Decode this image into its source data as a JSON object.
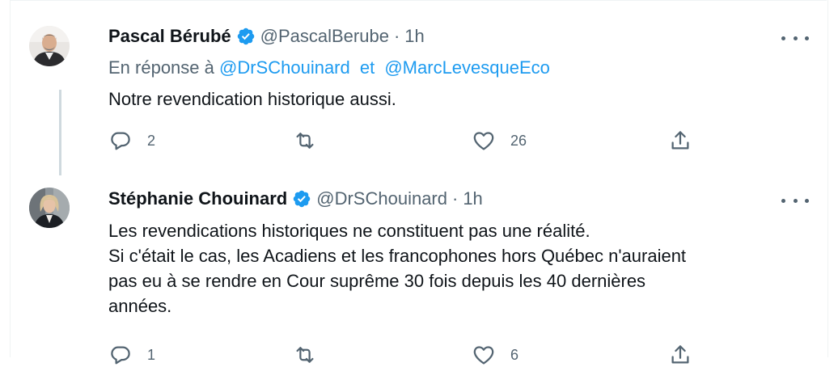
{
  "tweets": [
    {
      "name": "Pascal Bérubé",
      "handle": "@PascalBerube",
      "separator": "·",
      "time": "1h",
      "reply_prefix": "En réponse à",
      "reply_user1": "@DrSChouinard",
      "reply_join": "et",
      "reply_user2": "@MarcLevesqueEco",
      "text": "Notre revendication historique aussi.",
      "replies": "2",
      "retweets": "",
      "likes": "26"
    },
    {
      "name": "Stéphanie Chouinard",
      "handle": "@DrSChouinard",
      "separator": "·",
      "time": "1h",
      "text_lines": [
        "Les revendications historiques ne constituent pas une réalité.",
        "Si c'était le cas, les Acadiens et les francophones hors Québec n'auraient",
        "pas eu à se rendre en Cour suprême 30 fois depuis les 40 dernières",
        "années."
      ],
      "replies": "1",
      "retweets": "",
      "likes": "6"
    }
  ],
  "colors": {
    "text": "#0f1419",
    "secondary": "#536471",
    "link": "#1d9bf0",
    "verified": "#1d9bf0",
    "thread_line": "#cfd9de"
  }
}
